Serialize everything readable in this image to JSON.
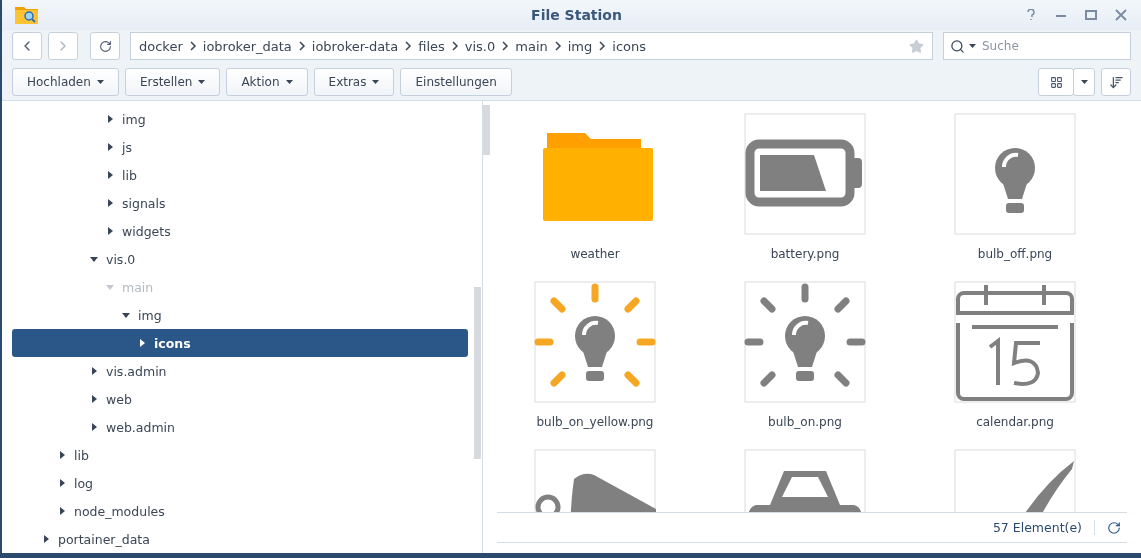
{
  "window": {
    "title": "File Station"
  },
  "path": [
    "docker",
    "iobroker_data",
    "iobroker-data",
    "files",
    "vis.0",
    "main",
    "img",
    "icons"
  ],
  "search": {
    "placeholder": "Suche"
  },
  "toolbar": [
    {
      "label": "Hochladen",
      "dropdown": true
    },
    {
      "label": "Erstellen",
      "dropdown": true
    },
    {
      "label": "Aktion",
      "dropdown": true
    },
    {
      "label": "Extras",
      "dropdown": true
    },
    {
      "label": "Einstellungen",
      "dropdown": false
    }
  ],
  "tree": [
    {
      "children": [
        {
          "children": [
            {
              "children": [
                {
                  "children": [
                    {
                      "label": "img",
                      "expanded": false,
                      "selected": false,
                      "dimmed": false
                    },
                    {
                      "label": "js",
                      "expanded": false,
                      "selected": false,
                      "dimmed": false
                    },
                    {
                      "label": "lib",
                      "expanded": false,
                      "selected": false,
                      "dimmed": false
                    },
                    {
                      "label": "signals",
                      "expanded": false,
                      "selected": false,
                      "dimmed": false
                    },
                    {
                      "label": "widgets",
                      "expanded": false,
                      "selected": false,
                      "dimmed": false
                    }
                  ]
                },
                {
                  "label": "vis.0",
                  "expanded": true,
                  "selected": false,
                  "dimmed": false,
                  "children": [
                    {
                      "label": "main",
                      "expanded": true,
                      "selected": false,
                      "dimmed": true,
                      "children": [
                        {
                          "label": "img",
                          "expanded": true,
                          "selected": false,
                          "dimmed": false,
                          "children": [
                            {
                              "label": "icons",
                              "expanded": false,
                              "selected": true,
                              "dimmed": false
                            }
                          ]
                        }
                      ]
                    }
                  ]
                },
                {
                  "label": "vis.admin",
                  "expanded": false,
                  "selected": false,
                  "dimmed": false
                },
                {
                  "label": "web",
                  "expanded": false,
                  "selected": false,
                  "dimmed": false
                },
                {
                  "label": "web.admin",
                  "expanded": false,
                  "selected": false,
                  "dimmed": false
                }
              ]
            }
          ]
        },
        {
          "label": "lib",
          "expanded": false,
          "selected": false,
          "dimmed": false
        },
        {
          "label": "log",
          "expanded": false,
          "selected": false,
          "dimmed": false
        },
        {
          "label": "node_modules",
          "expanded": false,
          "selected": false,
          "dimmed": false
        }
      ]
    },
    {
      "label": "portainer_data",
      "expanded": false,
      "selected": false,
      "dimmed": false
    }
  ],
  "files": [
    {
      "name": "weather",
      "kind": "folder"
    },
    {
      "name": "battery.png",
      "kind": "battery"
    },
    {
      "name": "bulb_off.png",
      "kind": "bulb"
    },
    {
      "name": "bulb_on_yellow.png",
      "kind": "sunbulb",
      "color": "#f5a623"
    },
    {
      "name": "bulb_on.png",
      "kind": "sunbulb",
      "color": "#808080"
    },
    {
      "name": "calendar.png",
      "kind": "calendar"
    },
    {
      "kind": "camera"
    },
    {
      "kind": "car"
    },
    {
      "kind": "check"
    }
  ],
  "status": {
    "count": "57 Element(e)"
  }
}
